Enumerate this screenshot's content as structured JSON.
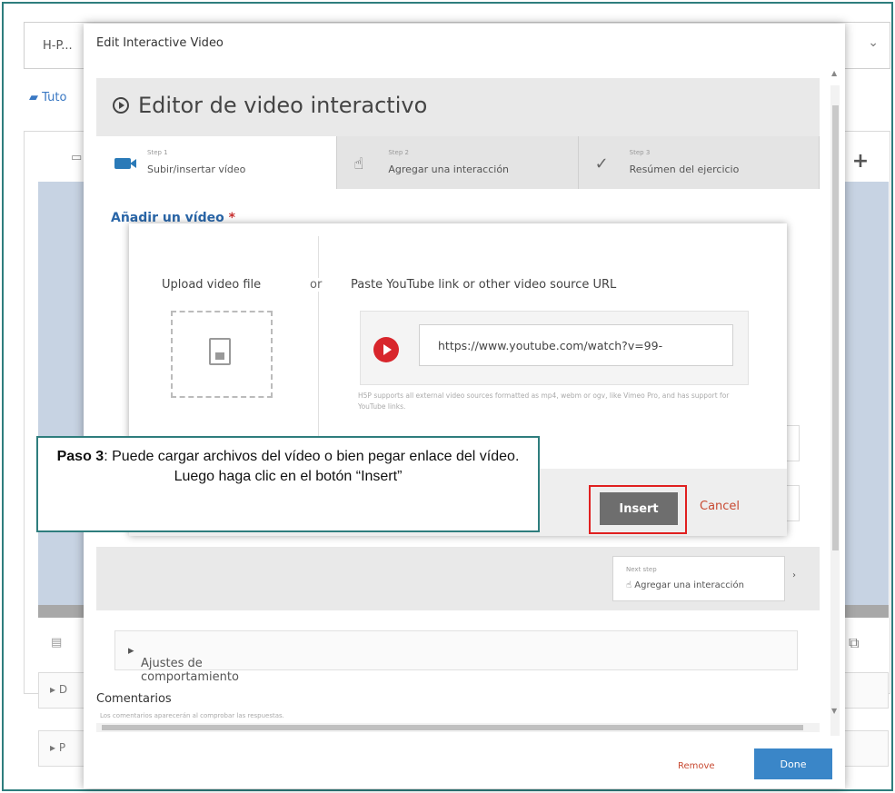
{
  "background": {
    "title": "H-P...",
    "breadcrumb": "Tuto"
  },
  "dialog": {
    "title": "Edit Interactive Video",
    "editor_title": "Editor de video interactivo",
    "steps": [
      {
        "small": "Step 1",
        "label": "Subir/insertar vídeo"
      },
      {
        "small": "Step 2",
        "label": "Agregar una interacción"
      },
      {
        "small": "Step 3",
        "label": "Resúmen del ejercicio"
      }
    ],
    "add_video_label": "Añadir un vídeo",
    "required_mark": "*",
    "next_step": {
      "small": "Next step",
      "label": "Agregar una interacción",
      "arrow": "›"
    },
    "behavior_label": "Ajustes de comportamiento",
    "comments_label": "Comentarios",
    "comments_sub": "Los comentarios aparecerán al comprobar las respuestas.",
    "remove_label": "Remove",
    "done_label": "Done"
  },
  "upload": {
    "upload_label": "Upload video file",
    "or_label": "or",
    "paste_label": "Paste YouTube link or other video source URL",
    "url_value": "https://www.youtube.com/watch?v=99-",
    "help_text": "H5P supports all external video sources formatted as mp4, webm or ogv, like Vimeo Pro, and has support for YouTube links.",
    "insert_label": "Insert",
    "cancel_label": "Cancel"
  },
  "callout": {
    "bold": "Paso 3",
    "text": ": Puede cargar archivos del vídeo o bien pegar enlace del vídeo. Luego haga clic en el botón “Insert”"
  }
}
